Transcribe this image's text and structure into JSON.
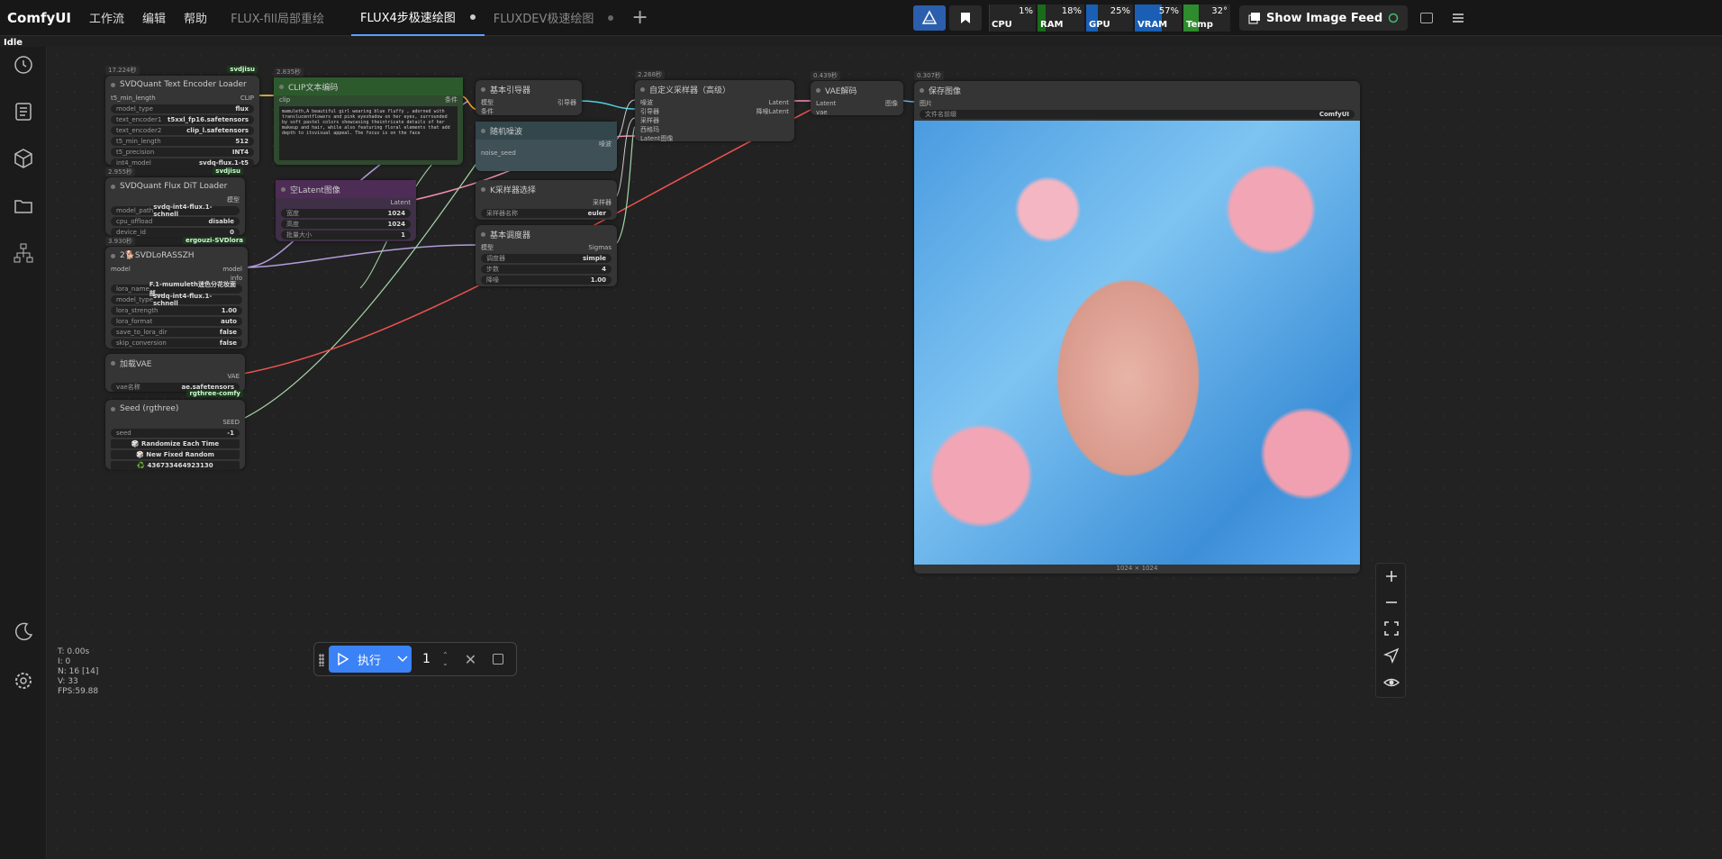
{
  "app": {
    "logo": "ComfyUI",
    "menu": [
      "工作流",
      "编辑",
      "帮助"
    ],
    "status": "Idle"
  },
  "tabs": [
    {
      "label": "FLUX-fill局部重绘",
      "active": false
    },
    {
      "label": "FLUX4步极速绘图",
      "active": true
    },
    {
      "label": "FLUXDEV极速绘图",
      "active": false
    }
  ],
  "sysmon": {
    "cpu": {
      "label": "CPU",
      "value": "1%",
      "level": 0.01,
      "color": "#3a3a3a"
    },
    "ram": {
      "label": "RAM",
      "value": "18%",
      "level": 0.18,
      "color": "#1a6b1a"
    },
    "gpu": {
      "label": "GPU",
      "value": "25%",
      "level": 0.25,
      "color": "#1a5fb4"
    },
    "vram": {
      "label": "VRAM",
      "value": "57%",
      "level": 0.57,
      "color": "#1a5fb4"
    },
    "temp": {
      "label": "Temp",
      "value": "32°",
      "level": 0.32,
      "color": "#2e8b2e"
    }
  },
  "feed_button": "Show Image Feed",
  "nodes": {
    "text_encoder": {
      "time": "17.224秒",
      "tag": "svdjisu",
      "title": "SVDQuant Text Encoder Loader",
      "in": "t5_min_length",
      "out": "CLIP",
      "widgets": [
        [
          "model_type",
          "flux"
        ],
        [
          "text_encoder1",
          "t5xxl_fp16.safetensors"
        ],
        [
          "text_encoder2",
          "clip_l.safetensors"
        ],
        [
          "t5_min_length",
          "512"
        ],
        [
          "t5_precision",
          "INT4"
        ],
        [
          "int4_model",
          "svdq-flux.1-t5"
        ]
      ]
    },
    "clip_encode": {
      "time": "2.835秒",
      "title": "CLIP文本编码",
      "in": "clip",
      "out": "条件",
      "text": "mamuleth,A beautiful girl wearing blue fluffy , adorned with translucentflowers and pink eyeshadow on her eyes, surrounded by soft pastel colors showcasing theintricate details of her makeup and hair, while also featuring floral elements that add depth to itsvisual appeal. The focus is on the face"
    },
    "dit_loader": {
      "time": "2.955秒",
      "tag": "svdjisu",
      "title": "SVDQuant Flux DiT Loader",
      "out": "模型",
      "widgets": [
        [
          "model_path",
          "svdq-int4-flux.1-schnell"
        ],
        [
          "cpu_offload",
          "disable"
        ],
        [
          "device_id",
          "0"
        ]
      ]
    },
    "lora": {
      "time": "3.930秒",
      "tag": "ergouzi-SVDlora",
      "title": "2🐕SVDLoRASSZH",
      "in": "model",
      "out": "model",
      "out2": "info",
      "widgets": [
        [
          "lora_name",
          "F.1-mumuleth迷色分花妆面部..."
        ],
        [
          "model_type",
          "svdq-int4-flux.1-schnell"
        ],
        [
          "lora_strength",
          "1.00"
        ],
        [
          "lora_format",
          "auto"
        ],
        [
          "save_to_lora_dir",
          "false"
        ],
        [
          "skip_conversion",
          "false"
        ]
      ]
    },
    "vae_loader": {
      "title": "加载VAE",
      "out": "VAE",
      "widgets": [
        [
          "vae名称",
          "ae.safetensors"
        ]
      ]
    },
    "seed": {
      "tag": "rgthree-comfy",
      "title": "Seed (rgthree)",
      "out": "SEED",
      "widgets": [
        [
          "seed",
          "-1"
        ]
      ],
      "buttons": [
        "🎲 Randomize Each Time",
        "🎲 New Fixed Random",
        "♻️ 436733464923130"
      ]
    },
    "empty_latent": {
      "title": "空Latent图像",
      "out": "Latent",
      "widgets": [
        [
          "宽度",
          "1024"
        ],
        [
          "高度",
          "1024"
        ],
        [
          "批量大小",
          "1"
        ]
      ]
    },
    "guider": {
      "title": "基本引导器",
      "in1": "模型",
      "in2": "条件",
      "out": "引导器"
    },
    "noise": {
      "title": "随机噪波",
      "in": "noise_seed",
      "out": "噪波"
    },
    "ksampler_select": {
      "title": "K采样器选择",
      "out": "采样器",
      "widgets": [
        [
          "采样器名称",
          "euler"
        ]
      ]
    },
    "scheduler": {
      "title": "基本调度器",
      "in": "模型",
      "out": "Sigmas",
      "widgets": [
        [
          "调度器",
          "simple"
        ],
        [
          "步数",
          "4"
        ],
        [
          "降噪",
          "1.00"
        ]
      ]
    },
    "custom_sampler": {
      "time": "2.268秒",
      "title": "自定义采样器（高级）",
      "ins": [
        "噪波",
        "引导器",
        "采样器",
        "西格玛",
        "Latent图像"
      ],
      "out1": "Latent",
      "out2": "降噪Latent"
    },
    "vae_decode": {
      "time": "0.439秒",
      "title": "VAE解码",
      "in1": "Latent",
      "in2": "vae",
      "out": "图像"
    },
    "save_image": {
      "time": "0.307秒",
      "title": "保存图像",
      "in": "图片",
      "widget_k": "文件名前缀",
      "widget_v": "ComfyUI",
      "size": "1024 × 1024"
    }
  },
  "runbar": {
    "label": "执行",
    "count": "1"
  },
  "stats": [
    "T: 0.00s",
    "I: 0",
    "N: 16 [14]",
    "V: 33",
    "FPS:59.88"
  ]
}
